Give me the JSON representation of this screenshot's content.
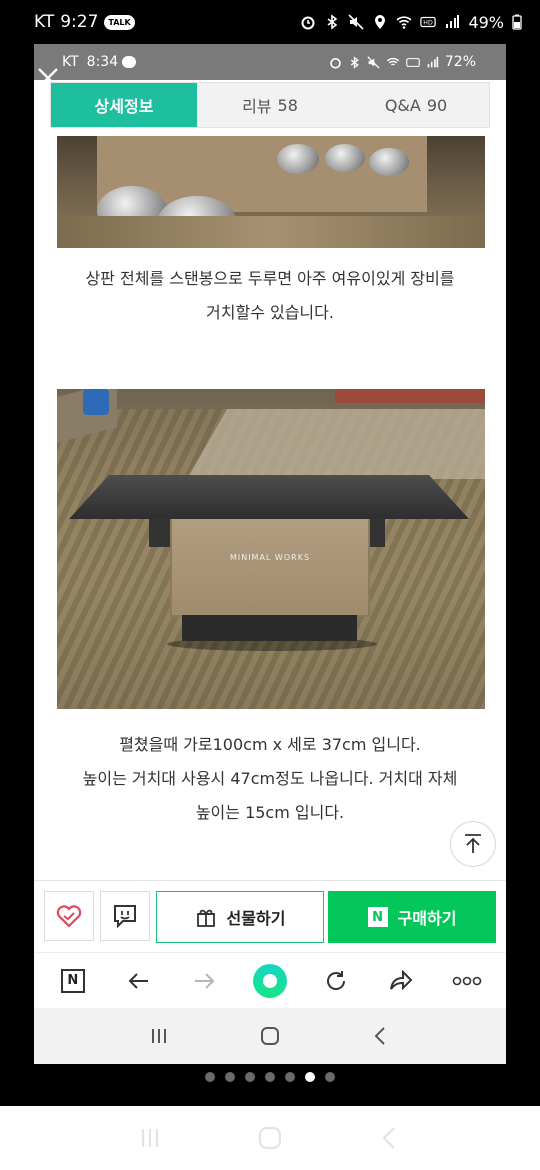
{
  "outer_status": {
    "carrier": "KT",
    "time": "9:27",
    "talk_badge": "TALK",
    "battery": "49%"
  },
  "inner_status": {
    "carrier": "KT",
    "time": "8:34",
    "battery": "72%"
  },
  "tabs": [
    {
      "label": "상세정보",
      "count": ""
    },
    {
      "label": "리뷰",
      "count": "58"
    },
    {
      "label": "Q&A",
      "count": "90"
    }
  ],
  "content": {
    "para1_line1": "상판 전체를 스탠봉으로 두루면 아주 여유이있게 장비를",
    "para1_line2": "거치할수 있습니다.",
    "crate_brand": "MINIMAL WORKS",
    "para2_line1": "펼쳤을때 가로100cm x 세로 37cm 입니다.",
    "para2_line2": "높이는 거치대 사용시 47cm정도 나옵니다. 거치대 자체",
    "para2_line3": "높이는 15cm 입니다."
  },
  "actions": {
    "gift_label": "선물하기",
    "buy_label": "구매하기",
    "n_mark": "N"
  },
  "browser": {
    "n_mark": "N"
  },
  "pager": {
    "count": 7,
    "active_index": 5
  },
  "colors": {
    "tab_active": "#1dbf9f",
    "buy_green": "#03c75a",
    "heart_red": "#e0485e"
  }
}
